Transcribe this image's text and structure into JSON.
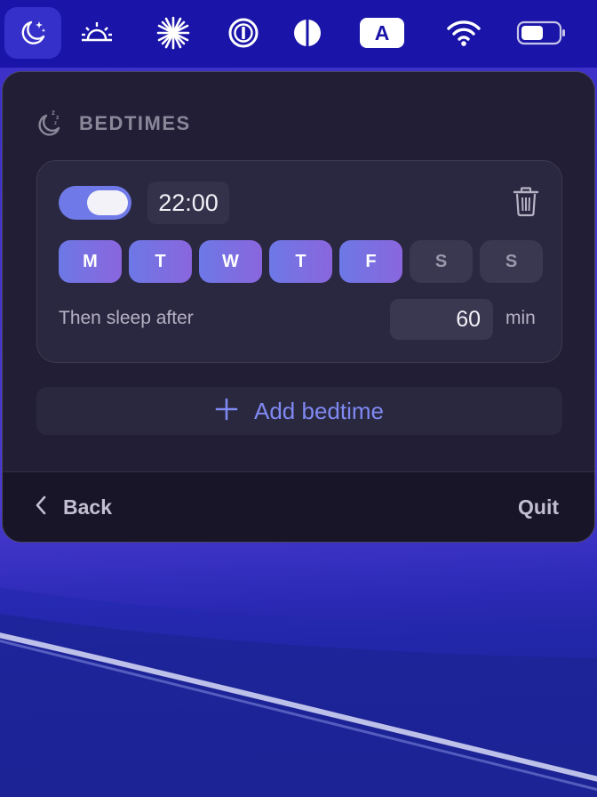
{
  "menubar": {
    "items": [
      {
        "icon": "moon-stars-icon",
        "active": true
      },
      {
        "icon": "sunrise-icon",
        "active": false
      },
      {
        "icon": "sparkle-icon",
        "active": false
      },
      {
        "icon": "password-manager-icon",
        "active": false
      },
      {
        "icon": "contrast-icon",
        "active": false
      },
      {
        "icon": "input-source-icon",
        "label": "A",
        "active": false
      },
      {
        "icon": "wifi-icon",
        "active": false
      },
      {
        "icon": "battery-icon",
        "level": 0.6,
        "active": false
      }
    ]
  },
  "panel": {
    "section_title": "BEDTIMES",
    "section_icon": "moon-zzz-icon",
    "bedtime": {
      "enabled": true,
      "time": "22:00",
      "days": [
        {
          "label": "M",
          "on": true
        },
        {
          "label": "T",
          "on": true
        },
        {
          "label": "W",
          "on": true
        },
        {
          "label": "T",
          "on": true
        },
        {
          "label": "F",
          "on": true
        },
        {
          "label": "S",
          "on": false
        },
        {
          "label": "S",
          "on": false
        }
      ],
      "sleep_label": "Then sleep after",
      "sleep_value": "60",
      "sleep_unit": "min"
    },
    "add_label": "Add bedtime",
    "back_label": "Back",
    "quit_label": "Quit"
  },
  "colors": {
    "accent": "#7f89f2",
    "toggle_on": "#6f7ae8",
    "day_on_start": "#6d78e6",
    "day_on_end": "#8a66dd",
    "panel_bg": "#211e36",
    "menubar_bg": "#1a14a8"
  }
}
